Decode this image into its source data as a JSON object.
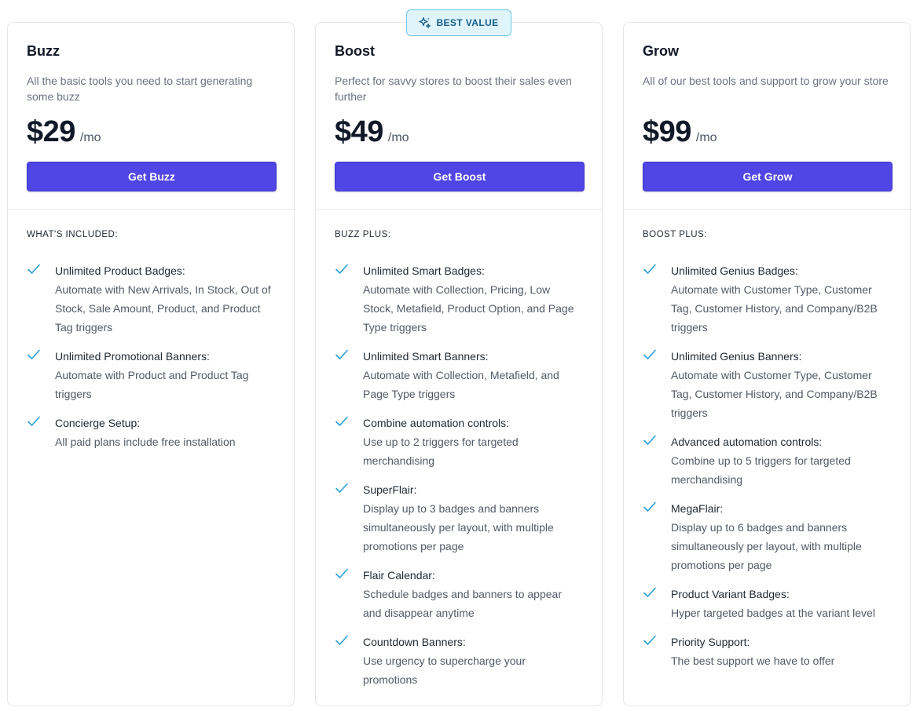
{
  "badge": {
    "label": "BEST VALUE",
    "icon": "sparkles-icon"
  },
  "colors": {
    "accent": "#4f46e5",
    "check": "#2b9fd9",
    "badge_bg": "#e0f4fb"
  },
  "plans": [
    {
      "name": "Buzz",
      "description": "All the basic tools you need to start generating some buzz",
      "price": "$29",
      "period": "/mo",
      "cta": "Get Buzz",
      "section_label": "WHAT'S INCLUDED:",
      "features": [
        {
          "title": "Unlimited Product Badges:",
          "desc": "Automate with New Arrivals, In Stock, Out of Stock, Sale Amount, Product, and Product Tag triggers"
        },
        {
          "title": "Unlimited Promotional Banners:",
          "desc": "Automate with Product and Product Tag triggers"
        },
        {
          "title": "Concierge Setup:",
          "desc": "All paid plans include free installation"
        }
      ]
    },
    {
      "name": "Boost",
      "description": "Perfect for savvy stores to boost their sales even further",
      "price": "$49",
      "period": "/mo",
      "cta": "Get Boost",
      "section_label": "BUZZ PLUS:",
      "features": [
        {
          "title": "Unlimited Smart Badges:",
          "desc": "Automate with Collection, Pricing, Low Stock, Metafield, Product Option, and Page Type triggers"
        },
        {
          "title": "Unlimited Smart Banners:",
          "desc": "Automate with Collection, Metafield, and Page Type triggers"
        },
        {
          "title": "Combine automation controls:",
          "desc": "Use up to 2 triggers for targeted merchandising"
        },
        {
          "title": "SuperFlair:",
          "desc": "Display up to 3 badges and banners simultaneously per layout, with multiple promotions per page"
        },
        {
          "title": "Flair Calendar:",
          "desc": "Schedule badges and banners to appear and disappear anytime"
        },
        {
          "title": "Countdown Banners:",
          "desc": "Use urgency to supercharge your promotions"
        }
      ]
    },
    {
      "name": "Grow",
      "description": "All of our best tools and support to grow your store",
      "price": "$99",
      "period": "/mo",
      "cta": "Get Grow",
      "section_label": "BOOST PLUS:",
      "features": [
        {
          "title": "Unlimited Genius Badges:",
          "desc": "Automate with Customer Type, Customer Tag, Customer History, and Company/B2B triggers"
        },
        {
          "title": "Unlimited Genius Banners:",
          "desc": "Automate with Customer Type, Customer Tag, Customer History, and Company/B2B triggers"
        },
        {
          "title": "Advanced automation controls:",
          "desc": "Combine up to 5 triggers for targeted merchandising"
        },
        {
          "title": "MegaFlair:",
          "desc": "Display up to 6 badges and banners simultaneously per layout, with multiple promotions per page"
        },
        {
          "title": "Product Variant Badges:",
          "desc": "Hyper targeted badges at the variant level"
        },
        {
          "title": "Priority Support:",
          "desc": "The best support we have to offer"
        }
      ]
    }
  ]
}
